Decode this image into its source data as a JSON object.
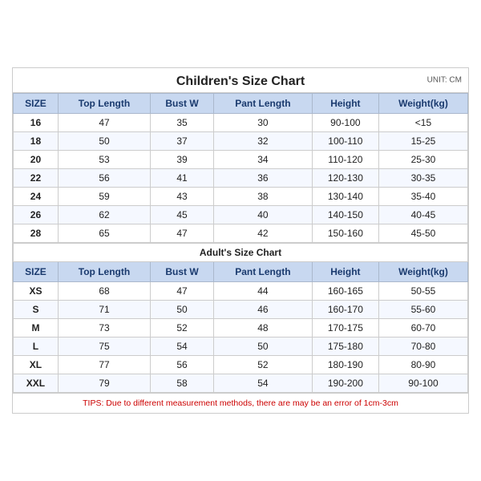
{
  "title": "Children's Size Chart",
  "unit": "UNIT: CM",
  "children_headers": [
    "SIZE",
    "Top Length",
    "Bust W",
    "Pant Length",
    "Height",
    "Weight(kg)"
  ],
  "children_rows": [
    [
      "16",
      "47",
      "35",
      "30",
      "90-100",
      "<15"
    ],
    [
      "18",
      "50",
      "37",
      "32",
      "100-110",
      "15-25"
    ],
    [
      "20",
      "53",
      "39",
      "34",
      "110-120",
      "25-30"
    ],
    [
      "22",
      "56",
      "41",
      "36",
      "120-130",
      "30-35"
    ],
    [
      "24",
      "59",
      "43",
      "38",
      "130-140",
      "35-40"
    ],
    [
      "26",
      "62",
      "45",
      "40",
      "140-150",
      "40-45"
    ],
    [
      "28",
      "65",
      "47",
      "42",
      "150-160",
      "45-50"
    ]
  ],
  "adult_title": "Adult's Size Chart",
  "adult_headers": [
    "SIZE",
    "Top Length",
    "Bust W",
    "Pant Length",
    "Height",
    "Weight(kg)"
  ],
  "adult_rows": [
    [
      "XS",
      "68",
      "47",
      "44",
      "160-165",
      "50-55"
    ],
    [
      "S",
      "71",
      "50",
      "46",
      "160-170",
      "55-60"
    ],
    [
      "M",
      "73",
      "52",
      "48",
      "170-175",
      "60-70"
    ],
    [
      "L",
      "75",
      "54",
      "50",
      "175-180",
      "70-80"
    ],
    [
      "XL",
      "77",
      "56",
      "52",
      "180-190",
      "80-90"
    ],
    [
      "XXL",
      "79",
      "58",
      "54",
      "190-200",
      "90-100"
    ]
  ],
  "tips": "TIPS: Due to different measurement methods, there are may be an error of 1cm-3cm"
}
